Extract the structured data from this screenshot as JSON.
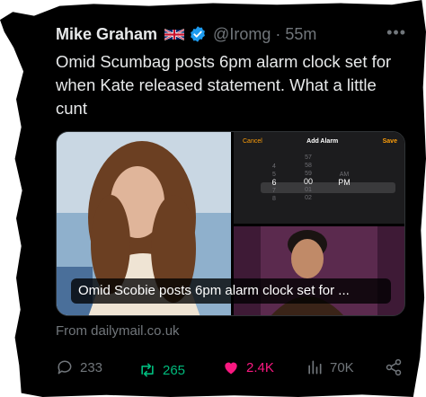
{
  "tweet": {
    "author_name": "Mike Graham",
    "handle": "@Iromg",
    "separator": "·",
    "time": "55m",
    "more": "•••",
    "text": "Omid Scumbag posts 6pm alarm clock set for when Kate released statement. What a little cunt"
  },
  "card": {
    "caption": "Omid Scobie posts 6pm alarm clock set for ...",
    "source": "From dailymail.co.uk",
    "alarm": {
      "cancel": "Cancel",
      "title": "Add Alarm",
      "save": "Save",
      "hours": [
        "4",
        "5",
        "6",
        "7",
        "8"
      ],
      "minutes": [
        "57",
        "58",
        "59",
        "00",
        "01",
        "02"
      ],
      "period": [
        "AM",
        "PM"
      ]
    }
  },
  "actions": {
    "replies": "233",
    "reposts": "265",
    "likes": "2.4K",
    "views": "70K"
  },
  "colors": {
    "background": "#000000",
    "text": "#e7e9ea",
    "muted": "#71767b",
    "verified": "#1d9bf0",
    "repost": "#00ba7c",
    "like": "#f91880"
  },
  "icons": [
    "uk-flag-icon",
    "verified-badge-icon",
    "reply-icon",
    "repost-icon",
    "like-heart-icon",
    "views-chart-icon",
    "share-icon"
  ]
}
